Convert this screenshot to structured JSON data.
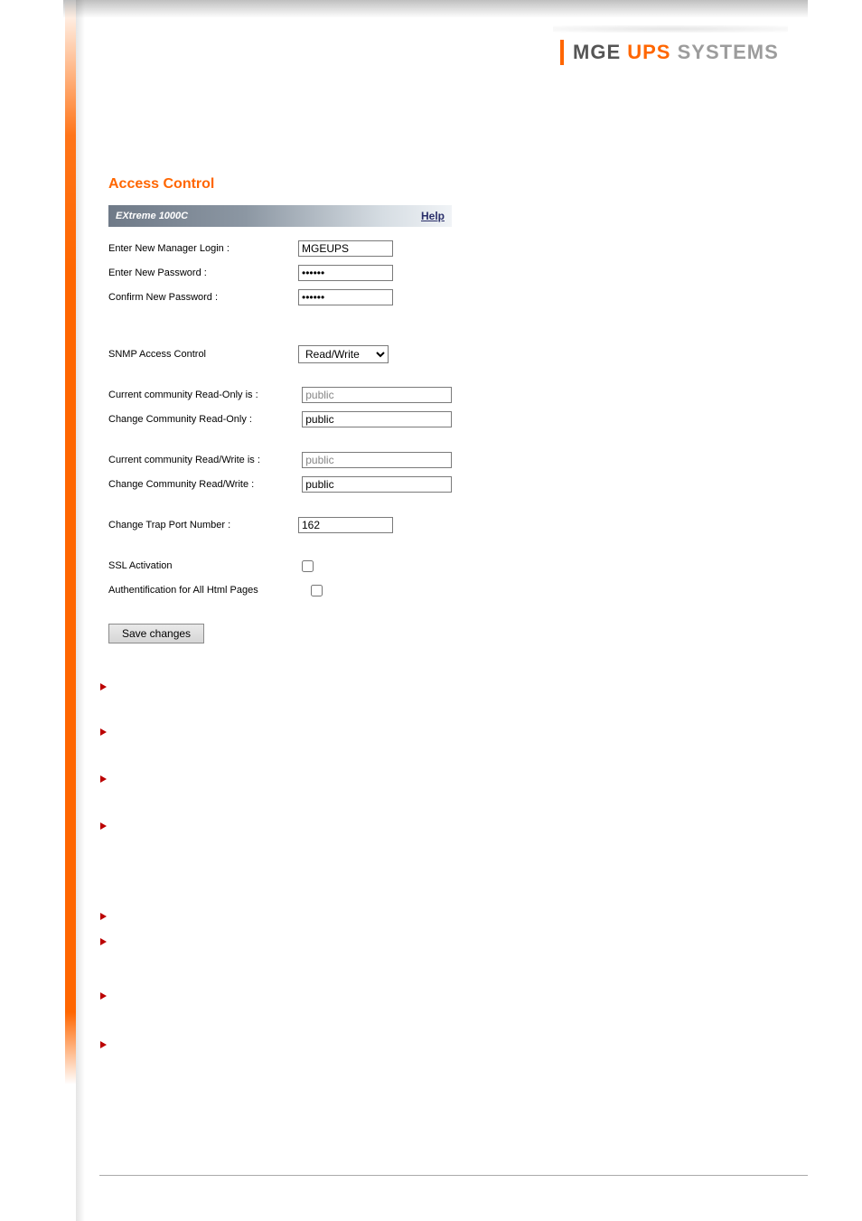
{
  "brand": {
    "part1": "MGE",
    "part2": "UPS",
    "part3": "SYSTEMS"
  },
  "page_title": "Access Control",
  "titlebar": {
    "device": "EXtreme 1000C",
    "help": "Help"
  },
  "fields": {
    "login_label": "Enter New Manager Login :",
    "login_value": "MGEUPS",
    "pwd_label": "Enter New Password :",
    "pwd_value": "••••••",
    "pwd2_label": "Confirm New Password :",
    "pwd2_value": "••••••",
    "snmp_label": "SNMP Access Control",
    "snmp_selected": "Read/Write",
    "snmp_options": [
      "Read/Write"
    ],
    "cur_ro_label": "Current community Read-Only is :",
    "cur_ro_value": "public",
    "chg_ro_label": "Change Community Read-Only :",
    "chg_ro_value": "public",
    "cur_rw_label": "Current community Read/Write is :",
    "cur_rw_value": "public",
    "chg_rw_label": "Change Community Read/Write :",
    "chg_rw_value": "public",
    "trap_label": "Change Trap Port Number :",
    "trap_value": "162",
    "ssl_label": "SSL Activation",
    "auth_label": "Authentification for All Html Pages"
  },
  "buttons": {
    "save": "Save changes"
  }
}
